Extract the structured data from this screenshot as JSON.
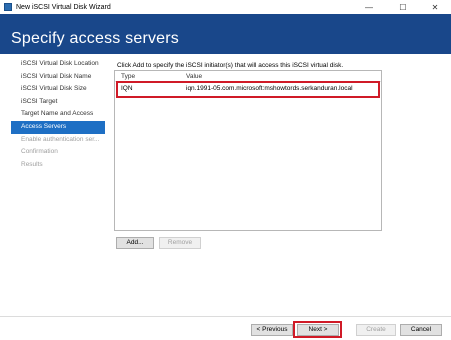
{
  "window": {
    "title": "New iSCSI Virtual Disk Wizard",
    "controls": [
      "—",
      "☐",
      "✕"
    ]
  },
  "header": {
    "title": "Specify access servers"
  },
  "sidebar": {
    "items": [
      {
        "label": "iSCSI Virtual Disk Location",
        "state": "normal"
      },
      {
        "label": "iSCSI Virtual Disk Name",
        "state": "normal"
      },
      {
        "label": "iSCSI Virtual Disk Size",
        "state": "normal"
      },
      {
        "label": "iSCSI Target",
        "state": "normal"
      },
      {
        "label": "Target Name and Access",
        "state": "normal"
      },
      {
        "label": "Access Servers",
        "state": "active"
      },
      {
        "label": "Enable authentication ser...",
        "state": "disabled"
      },
      {
        "label": "Confirmation",
        "state": "disabled"
      },
      {
        "label": "Results",
        "state": "disabled"
      }
    ]
  },
  "main": {
    "instruction": "Click Add to specify the iSCSI initiator(s) that will access this iSCSI virtual disk.",
    "columns": {
      "type": "Type",
      "value": "Value"
    },
    "rows": [
      {
        "type": "IQN",
        "value": "iqn.1991-05.com.microsoft:mshowtords.serkanduran.local"
      }
    ],
    "add_button": "Add...",
    "remove_button": "Remove"
  },
  "footer": {
    "previous": "< Previous",
    "next": "Next >",
    "create": "Create",
    "cancel": "Cancel"
  },
  "colors": {
    "header_band": "#19478a",
    "active_item": "#1e6fc4",
    "highlight_box": "#d01a27"
  }
}
